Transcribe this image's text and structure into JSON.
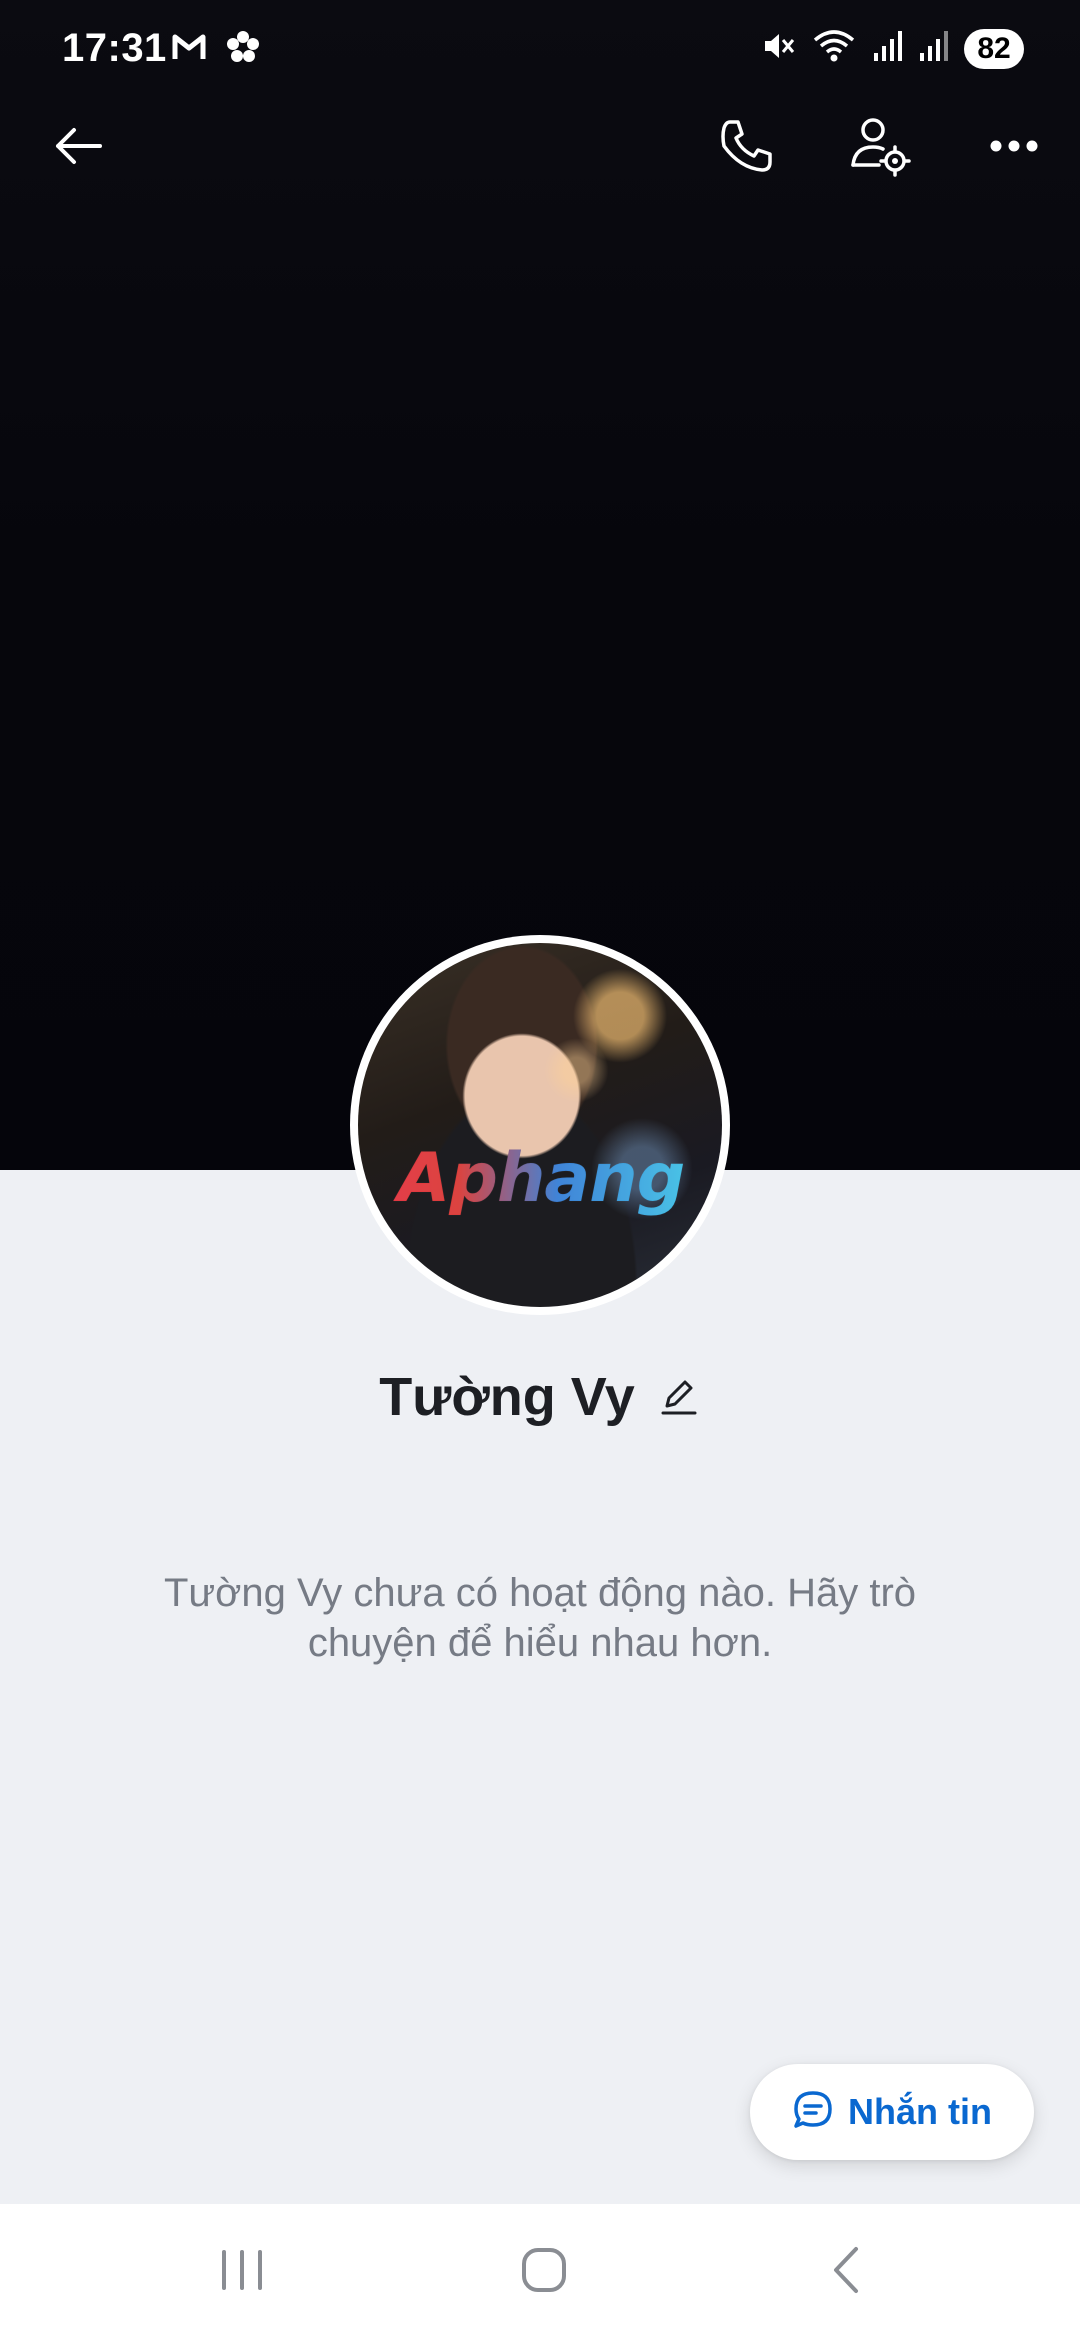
{
  "status_bar": {
    "time": "17:31",
    "left_icons": [
      "gmail-icon",
      "app-notification-icon"
    ],
    "right_icons": [
      "mute-icon",
      "wifi-icon",
      "signal-icon",
      "signal-icon"
    ],
    "battery": "82"
  },
  "top_bar": {
    "icons": [
      "back-arrow-icon",
      "phone-icon",
      "user-settings-icon",
      "more-dots-icon"
    ]
  },
  "profile": {
    "name": "Tường Vy",
    "avatar_watermark": "Aphang",
    "empty_message": "Tường Vy chưa có hoạt động nào. Hãy trò chuyện để hiểu nhau hơn."
  },
  "message_button": {
    "label": "Nhắn tin",
    "color": "#0a68d0"
  },
  "nav_bar": {
    "icons": [
      "recents-icon",
      "home-icon",
      "back-icon"
    ]
  },
  "colors": {
    "cover": "#06060c",
    "background": "#eef0f4",
    "accent": "#0a68d0"
  }
}
